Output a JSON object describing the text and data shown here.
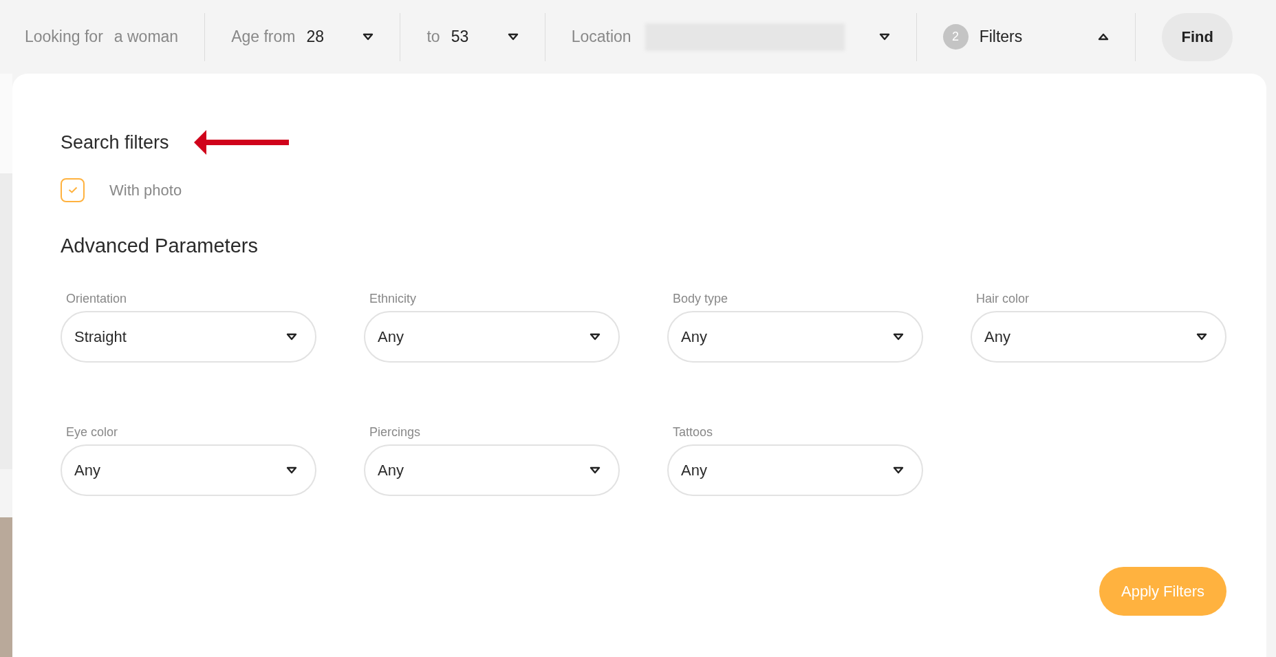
{
  "search_bar": {
    "looking_for": {
      "label": "Looking for",
      "value": "a woman"
    },
    "age_from": {
      "label": "Age from",
      "value": "28"
    },
    "age_to": {
      "label": "to",
      "value": "53"
    },
    "location": {
      "label": "Location"
    },
    "filters": {
      "count": "2",
      "label": "Filters",
      "expanded": true
    },
    "find_button": "Find"
  },
  "panel": {
    "title": "Search filters",
    "with_photo": {
      "label": "With photo",
      "checked": true
    },
    "advanced_title": "Advanced Parameters",
    "selects": [
      {
        "label": "Orientation",
        "value": "Straight"
      },
      {
        "label": "Ethnicity",
        "value": "Any"
      },
      {
        "label": "Body type",
        "value": "Any"
      },
      {
        "label": "Hair color",
        "value": "Any"
      },
      {
        "label": "Eye color",
        "value": "Any"
      },
      {
        "label": "Piercings",
        "value": "Any"
      },
      {
        "label": "Tattoos",
        "value": "Any"
      }
    ],
    "apply_button": "Apply Filters"
  }
}
